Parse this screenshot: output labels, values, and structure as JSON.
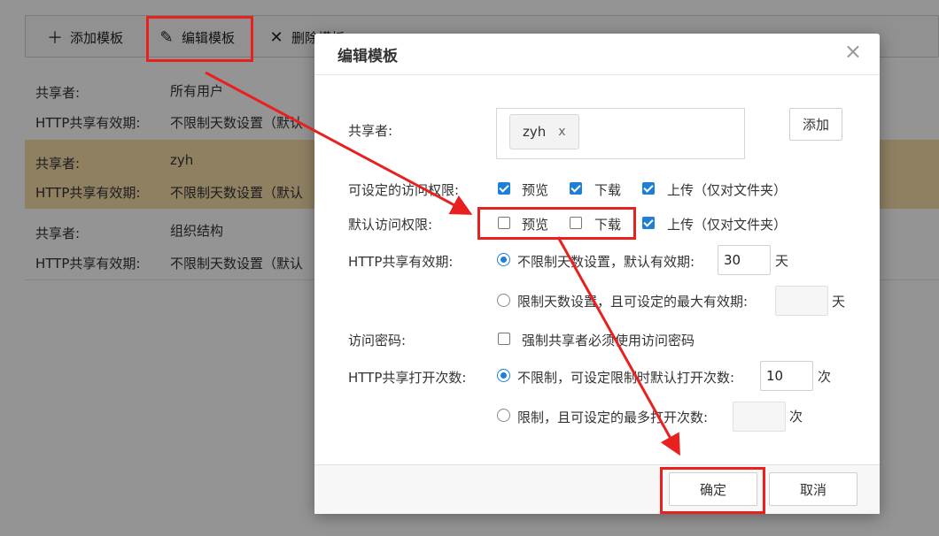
{
  "toolbar": {
    "add_label": "添加模板",
    "edit_label": "编辑模板",
    "delete_label": "删除模板"
  },
  "templates": [
    {
      "sharer_label": "共享者:",
      "sharer_value": "所有用户",
      "expiry_label": "HTTP共享有效期:",
      "expiry_value": "不限制天数设置（默认"
    },
    {
      "sharer_label": "共享者:",
      "sharer_value": "zyh",
      "expiry_label": "HTTP共享有效期:",
      "expiry_value": "不限制天数设置（默认"
    },
    {
      "sharer_label": "共享者:",
      "sharer_value": "组织结构",
      "expiry_label": "HTTP共享有效期:",
      "expiry_value": "不限制天数设置（默认"
    }
  ],
  "dialog": {
    "title": "编辑模板",
    "close_symbol": "×",
    "sharer": {
      "label": "共享者:",
      "tag": "zyh",
      "tag_remove": "x",
      "add_button": "添加"
    },
    "settable_perm": {
      "label": "可设定的访问权限:",
      "options": [
        {
          "label": "预览",
          "checked": true
        },
        {
          "label": "下载",
          "checked": true
        },
        {
          "label": "上传（仅对文件夹）",
          "checked": true
        }
      ]
    },
    "default_perm": {
      "label": "默认访问权限:",
      "options": [
        {
          "label": "预览",
          "checked": false
        },
        {
          "label": "下载",
          "checked": false
        },
        {
          "label": "上传（仅对文件夹）",
          "checked": true
        }
      ]
    },
    "http_expiry": {
      "label": "HTTP共享有效期:",
      "opt1": "不限制天数设置，默认有效期:",
      "opt1_value": "30",
      "opt1_unit": "天",
      "opt2": "限制天数设置，且可设定的最大有效期:",
      "opt2_value": "",
      "opt2_unit": "天",
      "selected": 1
    },
    "password": {
      "label": "访问密码:",
      "option": "强制共享者必须使用访问密码",
      "checked": false
    },
    "open_count": {
      "label": "HTTP共享打开次数:",
      "opt1": "不限制，可设定限制时默认打开次数:",
      "opt1_value": "10",
      "opt1_unit": "次",
      "opt2": "限制，且可设定的最多打开次数:",
      "opt2_value": "",
      "opt2_unit": "次",
      "selected": 1
    },
    "ok_button": "确定",
    "cancel_button": "取消"
  },
  "colors": {
    "accent": "#1f7fd6",
    "highlight_row": "#f7dda9",
    "annotation": "#e8201e"
  }
}
